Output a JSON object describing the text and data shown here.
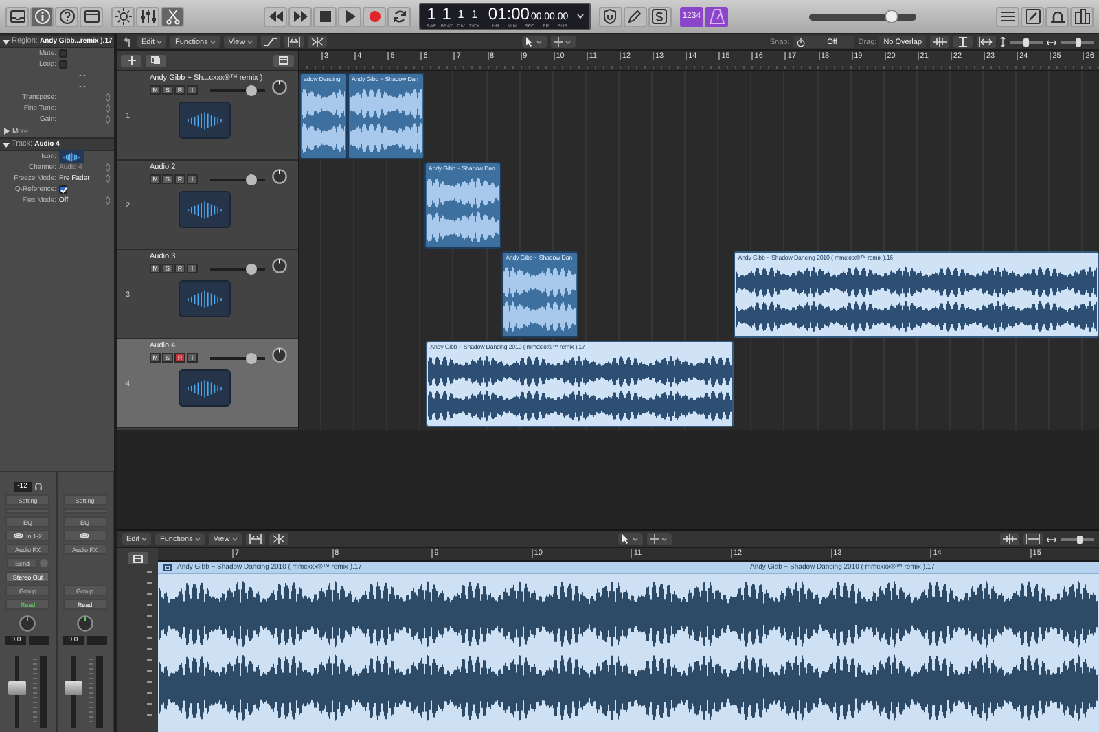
{
  "control_bar": {
    "lcd": {
      "position": [
        {
          "value": "1",
          "unit": "BAR"
        },
        {
          "value": "1",
          "unit": "BEAT"
        },
        {
          "value": "1",
          "unit": "DIV"
        },
        {
          "value": "1",
          "unit": "TICK"
        }
      ],
      "time": {
        "main": "01:00",
        "sub": "00.00.00",
        "units": [
          "HR",
          "MIN",
          "SEC",
          "FR",
          "SUB"
        ]
      }
    },
    "count_in": "1234",
    "master_volume": {
      "level": 0.78
    }
  },
  "inspector": {
    "region": {
      "label": "Region:",
      "name": "Andy Gibb...remix ).17",
      "expanded": true,
      "fields": [
        {
          "kind": "check",
          "label": "Mute:",
          "checked": false
        },
        {
          "kind": "check",
          "label": "Loop:",
          "checked": false
        },
        {
          "kind": "dash",
          "label": "- -"
        },
        {
          "kind": "dash",
          "label": "- -"
        },
        {
          "kind": "value",
          "label": "Transpose:"
        },
        {
          "kind": "value",
          "label": "Fine Tune:"
        },
        {
          "kind": "value",
          "label": "Gain:"
        }
      ],
      "more": "More"
    },
    "track": {
      "label": "Track:",
      "name": "Audio 4",
      "expanded": true,
      "fields": [
        {
          "kind": "icon",
          "label": "Icon:"
        },
        {
          "kind": "value",
          "label": "Channel:",
          "value": "Audio 4",
          "dim": true
        },
        {
          "kind": "value",
          "label": "Freeze Mode:",
          "value": "Pre Fader",
          "dim": false
        },
        {
          "kind": "check",
          "label": "Q-Reference:",
          "checked": true
        },
        {
          "kind": "value",
          "label": "Flex Mode:",
          "value": "Off",
          "dim": false
        }
      ]
    },
    "strips": [
      {
        "slots": [
          {
            "kind": "input",
            "text": "-12"
          },
          {
            "kind": "button",
            "text": "Setting"
          },
          {
            "kind": "blank"
          },
          {
            "kind": "button",
            "text": "EQ"
          },
          {
            "kind": "io",
            "text": "In 1-2"
          },
          {
            "kind": "button",
            "text": "Audio FX"
          },
          {
            "kind": "send",
            "text": "Send"
          },
          {
            "kind": "output",
            "text": "Stereo Out"
          },
          {
            "kind": "button",
            "text": "Group"
          },
          {
            "kind": "automation",
            "text": "Read",
            "active": true
          },
          {
            "kind": "pan"
          },
          {
            "kind": "value",
            "text": "0.0"
          }
        ],
        "fader": {
          "level": 0.55
        }
      },
      {
        "slots": [
          {
            "kind": "gap"
          },
          {
            "kind": "button",
            "text": "Setting"
          },
          {
            "kind": "blank"
          },
          {
            "kind": "button",
            "text": "EQ"
          },
          {
            "kind": "io"
          },
          {
            "kind": "button",
            "text": "Audio FX"
          },
          {
            "kind": "gap"
          },
          {
            "kind": "gap"
          },
          {
            "kind": "button",
            "text": "Group"
          },
          {
            "kind": "automation",
            "text": "Read",
            "active": false
          },
          {
            "kind": "pan"
          },
          {
            "kind": "value",
            "text": "0.0"
          }
        ],
        "fader": {
          "level": 0.55
        }
      }
    ]
  },
  "arrange": {
    "menus": [
      "Edit",
      "Functions",
      "View"
    ],
    "snap": {
      "label": "Snap:",
      "value": "Off"
    },
    "drag": {
      "label": "Drag:",
      "value": "No Overlap"
    },
    "zoom_sliders": [
      {
        "level": 0.5
      },
      {
        "level": 0.55
      }
    ],
    "ruler": [
      "3",
      "4",
      "5",
      "6",
      "7",
      "8",
      "9",
      "10",
      "11",
      "12",
      "13",
      "14",
      "15",
      "16",
      "17",
      "18",
      "19",
      "20",
      "21",
      "22",
      "23",
      "24",
      "25",
      "26"
    ],
    "tracks": [
      {
        "number": "1",
        "name": "Andy Gibb ~ Sh...cxxx®™ remix )",
        "selected": false,
        "record_armed": false,
        "buttons": [
          "M",
          "S",
          "R",
          "I"
        ],
        "volume": {
          "level": 0.75
        },
        "regions": [
          {
            "label": "adow Dancing",
            "selected": false
          },
          {
            "label": "Andy Gibb ~ Shadow Dan",
            "selected": false
          }
        ]
      },
      {
        "number": "2",
        "name": "Audio 2",
        "selected": false,
        "record_armed": false,
        "buttons": [
          "M",
          "S",
          "R",
          "I"
        ],
        "volume": {
          "level": 0.75
        },
        "regions": [
          {
            "label": "Andy Gibb ~ Shadow Dan",
            "selected": false
          }
        ]
      },
      {
        "number": "3",
        "name": "Audio 3",
        "selected": false,
        "record_armed": false,
        "buttons": [
          "M",
          "S",
          "R",
          "I"
        ],
        "volume": {
          "level": 0.75
        },
        "regions": [
          {
            "label": "Andy Gibb ~ Shadow Dan",
            "selected": false
          },
          {
            "label": "Andy Gibb ~ Shadow Dancing 2010 ( mmcxxx®™ remix ).16",
            "selected": true
          }
        ]
      },
      {
        "number": "4",
        "name": "Audio 4",
        "selected": true,
        "record_armed": true,
        "buttons": [
          "M",
          "S",
          "R",
          "I"
        ],
        "volume": {
          "level": 0.75
        },
        "regions": [
          {
            "label": "Andy Gibb ~ Shadow Dancing 2010 ( mmcxxx®™ remix ).17",
            "selected": true
          }
        ]
      }
    ]
  },
  "editor": {
    "menus": [
      "Edit",
      "Functions",
      "View"
    ],
    "zoom_slider": {
      "level": 0.6
    },
    "ruler": [
      "7",
      "8",
      "9",
      "10",
      "11",
      "12",
      "13",
      "14",
      "15"
    ],
    "region_labels": [
      "Andy Gibb ~ Shadow Dancing 2010 ( mmcxxx®™ remix ).17",
      "Andy Gibb ~ Shadow Dancing 2010 ( mmcxxx®™ remix ).17"
    ]
  }
}
